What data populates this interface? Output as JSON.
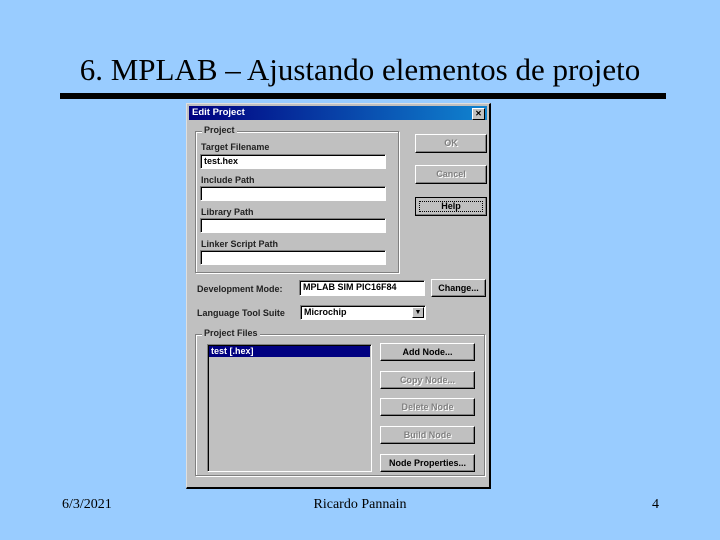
{
  "slide": {
    "title": "6. MPLAB – Ajustando elementos de projeto",
    "footer_date": "6/3/2021",
    "footer_author": "Ricardo Pannain",
    "footer_page": "4"
  },
  "dialog": {
    "title": "Edit Project",
    "close_glyph": "✕",
    "project_group": {
      "label": "Project",
      "target_filename_label": "Target Filename",
      "target_filename_value": "test.hex",
      "include_path_label": "Include Path",
      "include_path_value": "",
      "library_path_label": "Library Path",
      "library_path_value": "",
      "linker_script_label": "Linker Script Path",
      "linker_script_value": ""
    },
    "buttons": {
      "ok": "OK",
      "cancel": "Cancel",
      "help": "Help",
      "change": "Change...",
      "add_node": "Add Node...",
      "copy_node": "Copy Node...",
      "delete_node": "Delete Node",
      "build_node": "Build Node",
      "node_properties": "Node Properties..."
    },
    "development_mode_label": "Development Mode:",
    "development_mode_value": "MPLAB SIM PIC16F84",
    "language_tool_label": "Language Tool Suite",
    "language_tool_value": "Microchip",
    "dropdown_glyph": "▼",
    "project_files": {
      "label": "Project Files",
      "items": [
        "test [.hex]"
      ]
    }
  }
}
